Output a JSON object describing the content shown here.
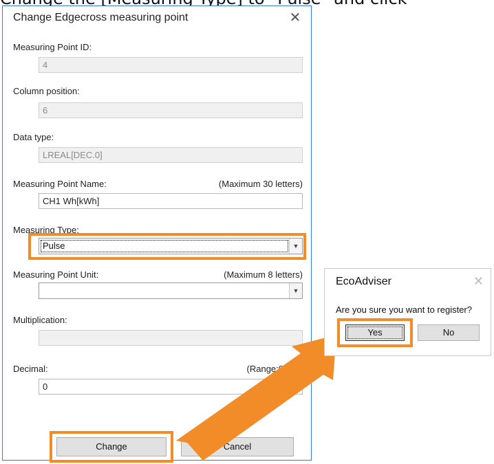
{
  "caption": "Change the [Measuring Type] to \"Pulse\" and click",
  "dialog": {
    "title": "Change Edgecross measuring point",
    "close_glyph": "✕",
    "measuring_point_id": {
      "label": "Measuring Point ID:",
      "value": "4"
    },
    "column_position": {
      "label": "Column position:",
      "value": "6"
    },
    "data_type": {
      "label": "Data type:",
      "value": "LREAL[DEC.0]"
    },
    "measuring_point_name": {
      "label": "Measuring Point Name:",
      "hint": "(Maximum 30 letters)",
      "value": "CH1 Wh[kWh]"
    },
    "measuring_type": {
      "label": "Measuring Type:",
      "value": "Pulse"
    },
    "measuring_point_unit": {
      "label": "Measuring Point Unit:",
      "hint": "(Maximum 8 letters)",
      "value": ""
    },
    "multiplication": {
      "label": "Multiplication:",
      "value": ""
    },
    "decimal": {
      "label": "Decimal:",
      "hint": "(Range:0",
      "value": "0"
    },
    "change_button": "Change",
    "cancel_button": "Cancel"
  },
  "confirm": {
    "title": "EcoAdviser",
    "close_glyph": "✕",
    "message": "Are you sure you want to register?",
    "yes_button": "Yes",
    "no_button": "No"
  },
  "icons": {
    "dropdown": "chevron-down-icon",
    "close": "close-icon",
    "arrow": "arrow-right-up-icon"
  },
  "colors": {
    "highlight": "#f28c28",
    "dialog_border": "#2f7fd0"
  }
}
